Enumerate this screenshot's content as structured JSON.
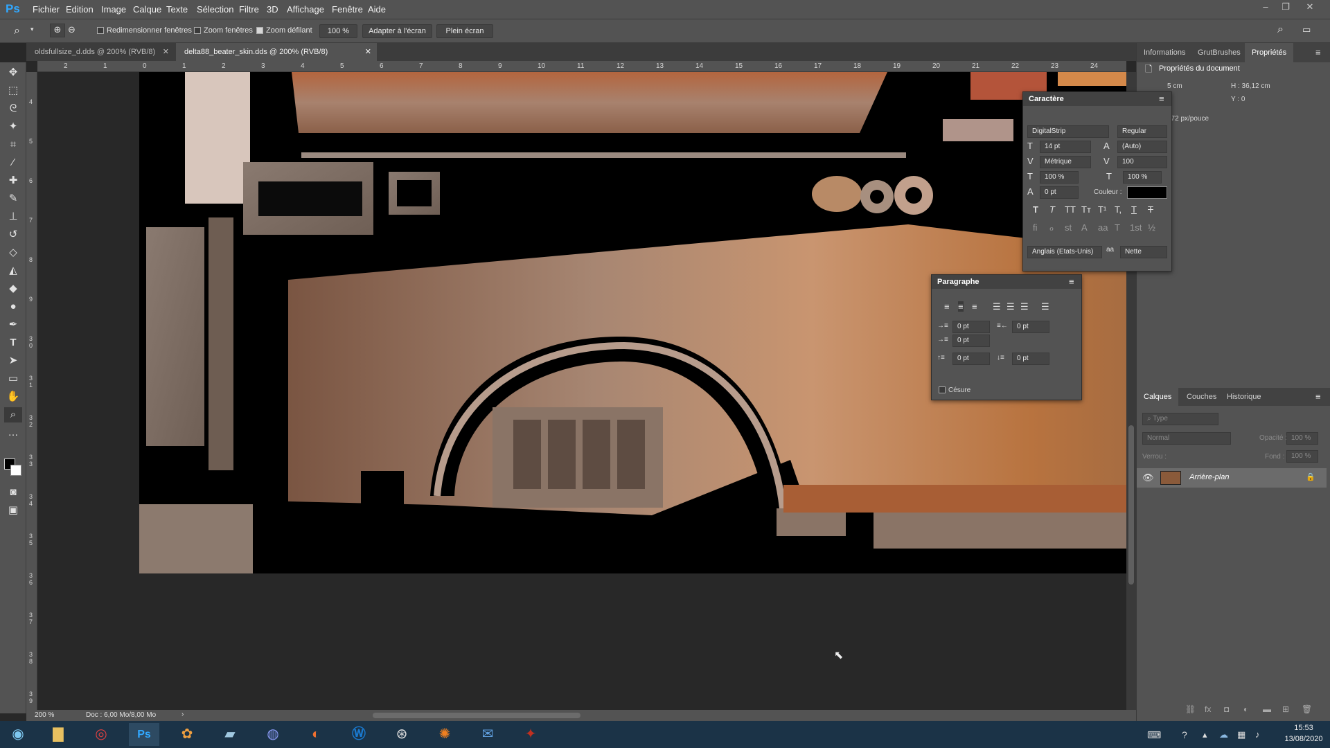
{
  "app": {
    "logo": "Ps"
  },
  "menu": [
    "Fichier",
    "Edition",
    "Image",
    "Calque",
    "Texte",
    "Sélection",
    "Filtre",
    "3D",
    "Affichage",
    "Fenêtre",
    "Aide"
  ],
  "options": {
    "resize_windows": "Redimensionner fenêtres",
    "zoom_windows": "Zoom fenêtres",
    "scrubby_zoom": "Zoom défilant",
    "zoom_value": "100 %",
    "fit_screen": "Adapter à l'écran",
    "full_screen": "Plein écran"
  },
  "tabs": [
    {
      "label": "oldsfullsize_d.dds @ 200% (RVB/8)"
    },
    {
      "label": "delta88_beater_skin.dds @ 200% (RVB/8)"
    }
  ],
  "ruler_h": [
    "2",
    "1",
    "0",
    "1",
    "2",
    "3",
    "4",
    "5",
    "6",
    "7",
    "8",
    "9",
    "10",
    "11",
    "12",
    "13",
    "14",
    "15",
    "16",
    "17",
    "18",
    "19",
    "20",
    "21",
    "22",
    "23",
    "24"
  ],
  "ruler_v": [
    "4",
    "5",
    "6",
    "7",
    "8",
    "9",
    "3 0",
    "3 1",
    "3 2",
    "3 3",
    "3 4",
    "3 5",
    "3 6",
    "3 7",
    "3 8",
    "3 9"
  ],
  "status": {
    "zoom": "200 %",
    "doc": "Doc : 6,00 Mo/8,00 Mo"
  },
  "right_tabs": {
    "info": "Informations",
    "grut": "GrutBrushes",
    "props": "Propriétés"
  },
  "properties": {
    "title": "Propriétés du document",
    "w": "5 cm",
    "h": "H :  36,12 cm",
    "y": "Y :  0",
    "res": ": 72 px/pouce"
  },
  "caractere": {
    "title": "Caractère",
    "font": "DigitalStrip",
    "style": "Regular",
    "size": "14 pt",
    "leading": "(Auto)",
    "kerning": "Métrique",
    "tracking": "100",
    "vscale": "100 %",
    "hscale": "100 %",
    "baseline": "0 pt",
    "color_label": "Couleur :",
    "color": "#000000",
    "language": "Anglais (Etats-Unis)",
    "aa": "Nette",
    "glyph_row1": [
      "T",
      "T",
      "TT",
      "Tт",
      "T¹",
      "T,",
      "T",
      "T"
    ],
    "glyph_row2": [
      "ﬁ",
      "ℴ",
      "st",
      "A",
      "aa",
      "T",
      "1st",
      "½"
    ]
  },
  "paragraphe": {
    "title": "Paragraphe",
    "indent_left": "0 pt",
    "indent_right": "0 pt",
    "indent_first": "0 pt",
    "space_before": "0 pt",
    "space_after": "0 pt",
    "hyphen": "Césure"
  },
  "layers_tabs": {
    "calques": "Calques",
    "couches": "Couches",
    "historique": "Historique"
  },
  "layers": {
    "filter": "Type",
    "blend": "Normal",
    "opacity_label": "Opacité :",
    "opacity": "100 %",
    "lock_label": "Verrou :",
    "fill_label": "Fond :",
    "fill": "100 %",
    "items": [
      {
        "name": "Arrière-plan"
      }
    ]
  },
  "taskbar": {
    "time": "15:53",
    "date": "13/08/2020",
    "icons": [
      "start-orb",
      "explorer",
      "chrome",
      "photoshop",
      "bug-app",
      "notepad",
      "discord",
      "firefox",
      "w-app",
      "steam",
      "blender",
      "mail-app",
      "game-app"
    ]
  }
}
